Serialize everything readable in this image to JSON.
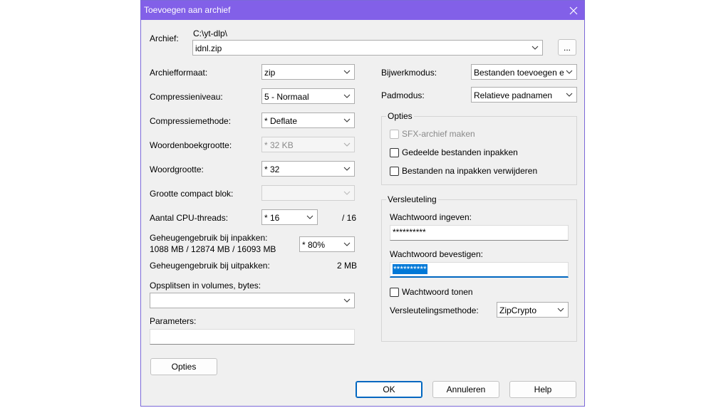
{
  "title": "Toevoegen aan archief",
  "archive": {
    "label": "Archief:",
    "path": "C:\\yt-dlp\\",
    "name": "idnl.zip",
    "browse": "..."
  },
  "left": {
    "format_label": "Archiefformaat:",
    "format_value": "zip",
    "level_label": "Compressieniveau:",
    "level_value": "5 - Normaal",
    "method_label": "Compressiemethode:",
    "method_value": "*  Deflate",
    "dict_label": "Woordenboekgrootte:",
    "dict_value": "*  32 KB",
    "word_label": "Woordgrootte:",
    "word_value": "*  32",
    "solid_label": "Grootte compact blok:",
    "solid_value": "",
    "threads_label": "Aantal CPU-threads:",
    "threads_value": "*  16",
    "threads_max": "/ 16",
    "mem_pack_label": "Geheugengebruik bij inpakken:",
    "mem_pack_detail": "1088 MB / 12874 MB / 16093 MB",
    "mem_pack_value": "*  80%",
    "mem_unpack_label": "Geheugengebruik bij uitpakken:",
    "mem_unpack_value": "2 MB",
    "split_label": "Opsplitsen in volumes, bytes:",
    "split_value": "",
    "params_label": "Parameters:",
    "params_value": "",
    "options_button": "Opties"
  },
  "right": {
    "update_label": "Bijwerkmodus:",
    "update_value": "Bestanden toevoegen en v",
    "path_label": "Padmodus:",
    "path_value": "Relatieve padnamen",
    "options_group": "Opties",
    "sfx": "SFX-archief maken",
    "shared": "Gedeelde bestanden inpakken",
    "delete_after": "Bestanden na inpakken verwijderen",
    "enc_group": "Versleuteling",
    "pw_label": "Wachtwoord ingeven:",
    "pw_value": "**********",
    "pw2_label": "Wachtwoord bevestigen:",
    "pw2_value": "**********",
    "show_pw": "Wachtwoord tonen",
    "enc_method_label": "Versleutelingsmethode:",
    "enc_method_value": "ZipCrypto"
  },
  "buttons": {
    "ok": "OK",
    "cancel": "Annuleren",
    "help": "Help"
  }
}
